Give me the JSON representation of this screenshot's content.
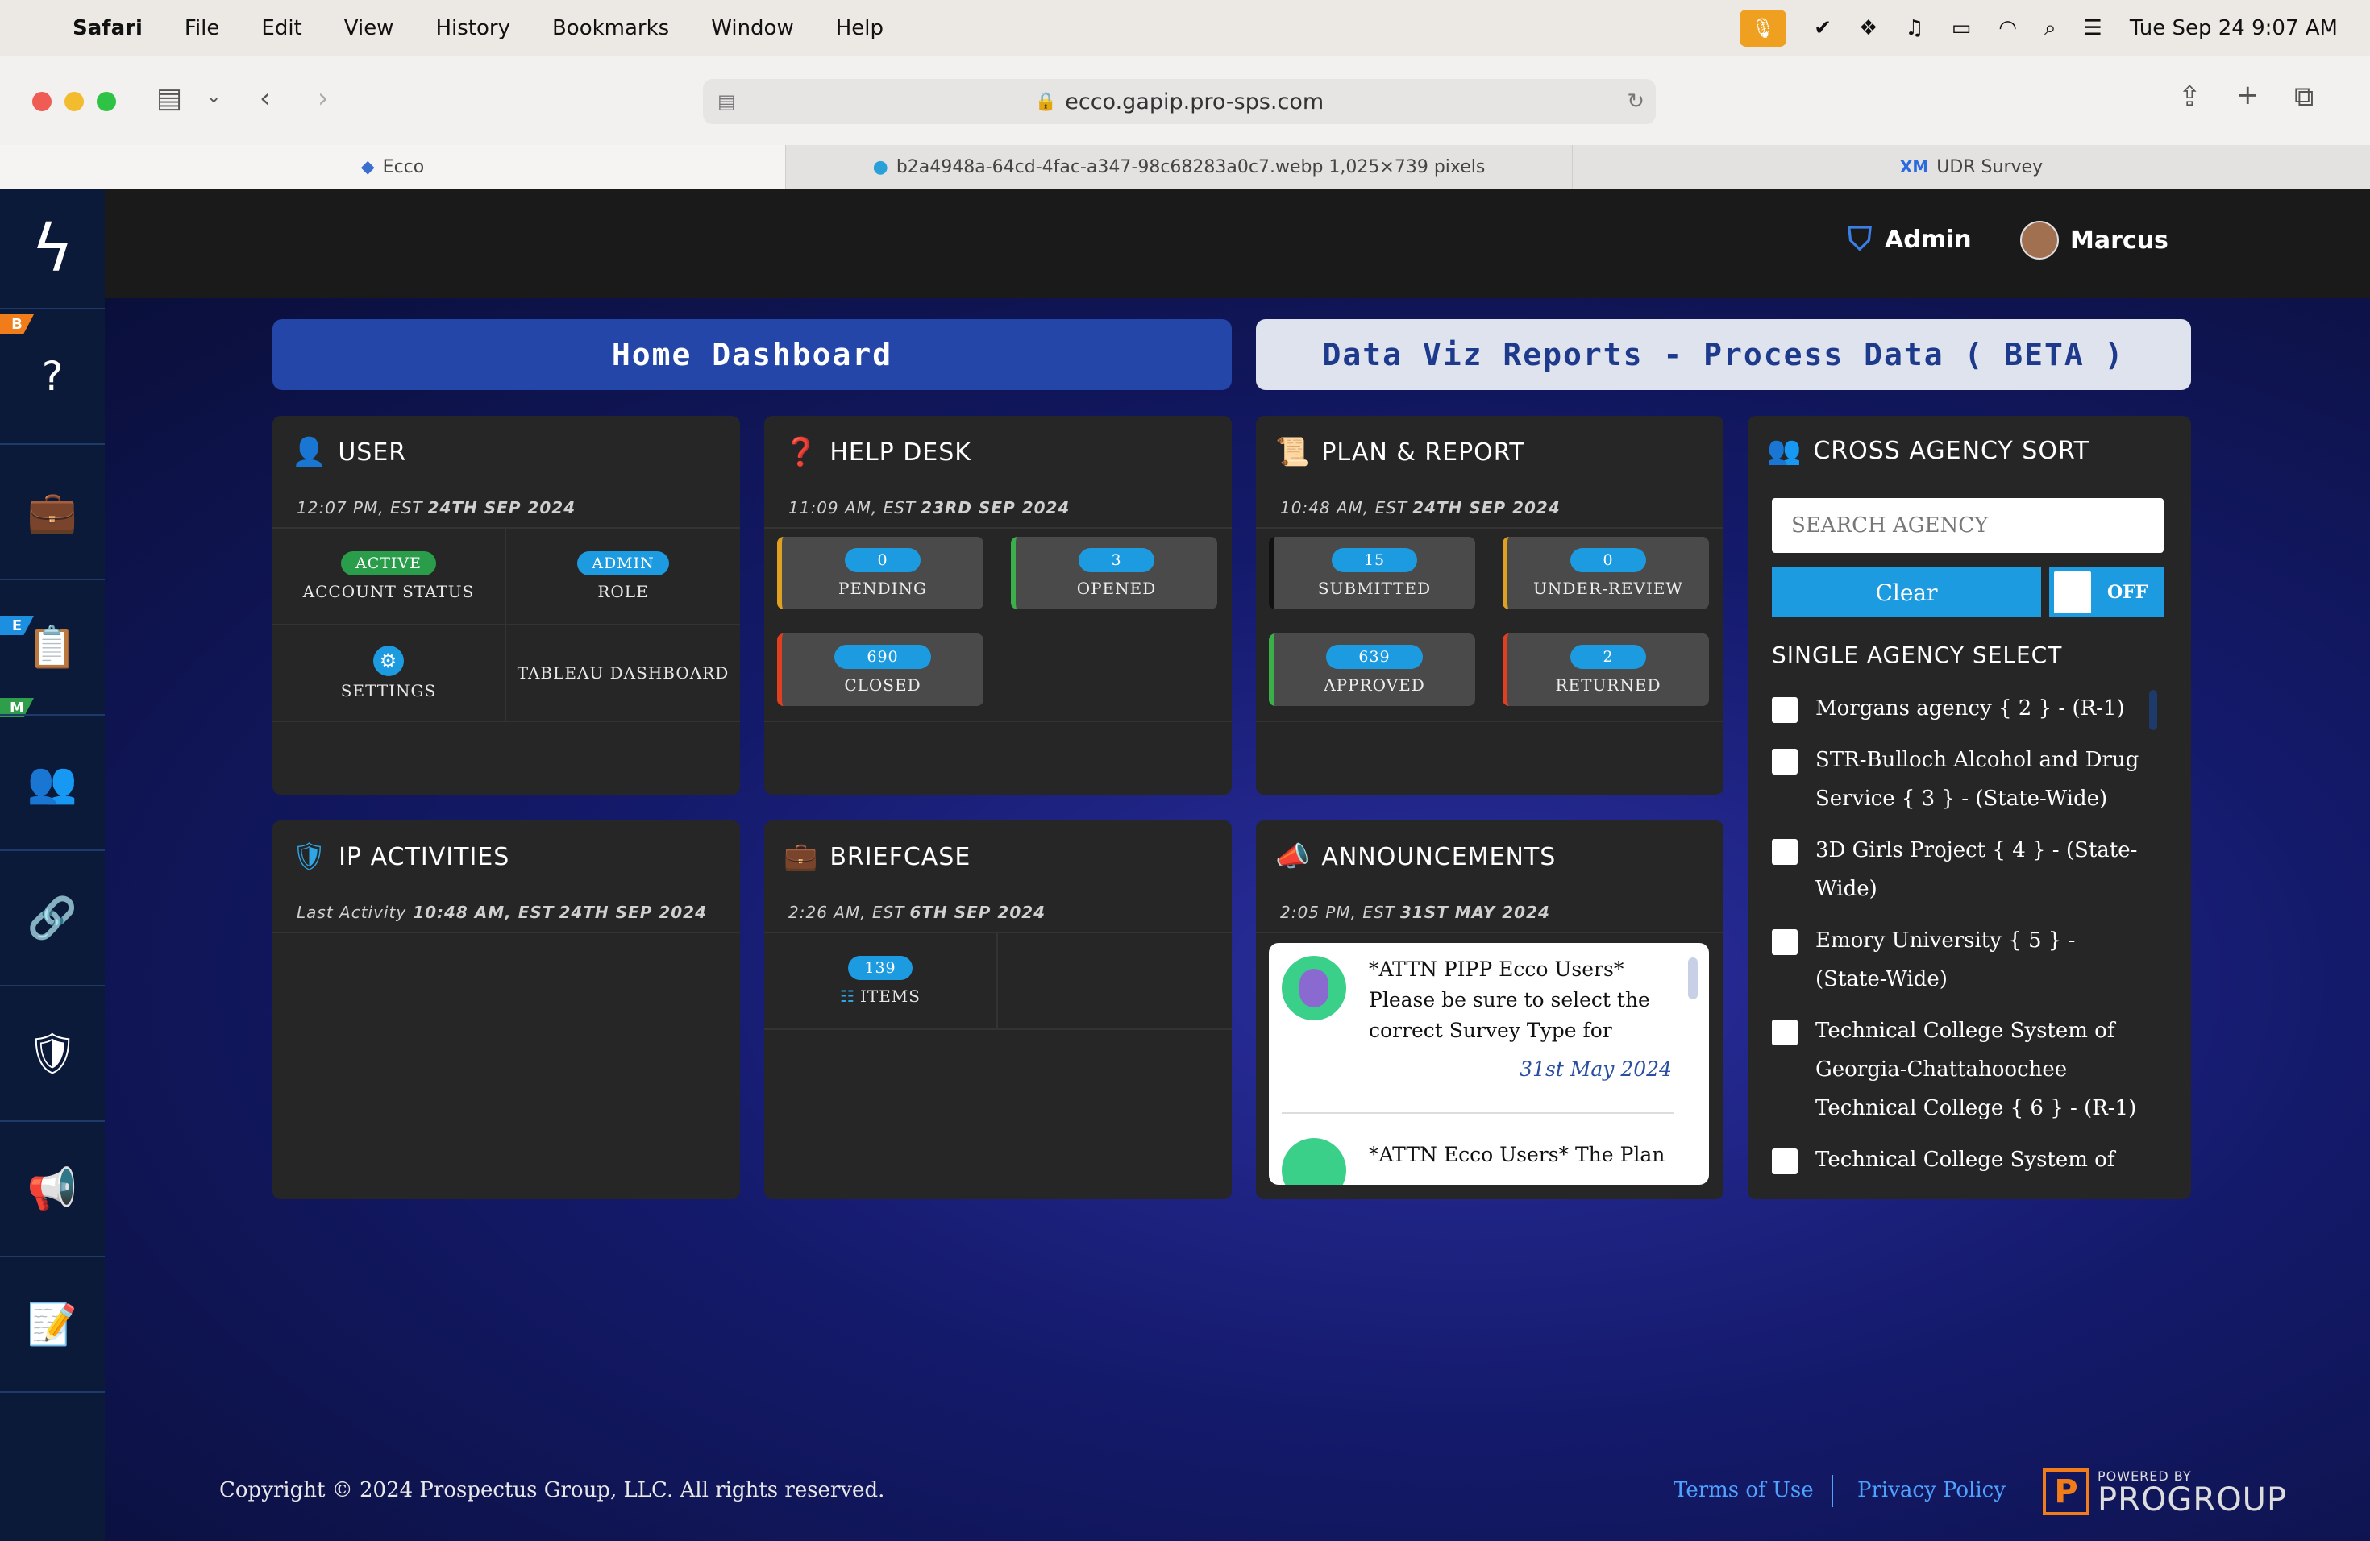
{
  "menubar": {
    "app": "Safari",
    "items": [
      "File",
      "Edit",
      "View",
      "History",
      "Bookmarks",
      "Window",
      "Help"
    ],
    "datetime": "Tue Sep 24  9:07 AM"
  },
  "browser": {
    "url": "ecco.gapip.pro-sps.com",
    "tabs": [
      {
        "label": "Ecco"
      },
      {
        "label": "b2a4948a-64cd-4fac-a347-98c68283a0c7.webp 1,025×739 pixels"
      },
      {
        "label": "UDR Survey"
      }
    ]
  },
  "topbar": {
    "admin_label": "Admin",
    "user_name": "Marcus"
  },
  "sidebar": {
    "badges": [
      "B",
      "E",
      "M"
    ]
  },
  "nav": {
    "home_dashboard": "Home Dashboard",
    "data_viz": "Data Viz Reports - Process Data ( BETA )"
  },
  "user_card": {
    "title": "USER",
    "time": "12:07 PM, EST",
    "date": "24TH SEP 2024",
    "status_pill": "ACTIVE",
    "status_label": "ACCOUNT STATUS",
    "role_pill": "ADMIN",
    "role_label": "ROLE",
    "settings_label": "SETTINGS",
    "tableau_label": "TABLEAU DASHBOARD"
  },
  "helpdesk_card": {
    "title": "HELP DESK",
    "time": "11:09 AM, EST",
    "date": "23RD SEP 2024",
    "pending": {
      "count": "0",
      "label": "PENDING"
    },
    "opened": {
      "count": "3",
      "label": "OPENED"
    },
    "closed": {
      "count": "690",
      "label": "CLOSED"
    }
  },
  "plan_card": {
    "title": "PLAN & REPORT",
    "time": "10:48 AM, EST",
    "date": "24TH SEP 2024",
    "submitted": {
      "count": "15",
      "label": "SUBMITTED"
    },
    "underreview": {
      "count": "0",
      "label": "UNDER-REVIEW"
    },
    "approved": {
      "count": "639",
      "label": "APPROVED"
    },
    "returned": {
      "count": "2",
      "label": "RETURNED"
    }
  },
  "ip_card": {
    "title": "IP ACTIVITIES",
    "prefix": "Last Activity",
    "time": "10:48 AM, EST",
    "date": "24TH SEP 2024"
  },
  "briefcase_card": {
    "title": "BRIEFCASE",
    "time": "2:26 AM, EST",
    "date": "6TH SEP 2024",
    "count": "139",
    "label": "ITEMS"
  },
  "announce_card": {
    "title": "ANNOUNCEMENTS",
    "time": "2:05 PM, EST",
    "date": "31ST MAY 2024",
    "items": [
      {
        "text": "*ATTN PIPP Ecco Users* Please be sure to select the correct Survey Type for",
        "date": "31st May 2024"
      },
      {
        "text": "*ATTN Ecco Users* The Plan"
      }
    ]
  },
  "agency_card": {
    "title": "CROSS AGENCY SORT",
    "search_placeholder": "SEARCH AGENCY",
    "clear_label": "Clear",
    "toggle_label": "OFF",
    "single_select": "SINGLE AGENCY SELECT",
    "agencies": [
      "Morgans agency { 2 } - (R-1)",
      "STR-Bulloch Alcohol and Drug Service { 3 } - (State-Wide)",
      "3D Girls Project { 4 } - (State-Wide)",
      "Emory University { 5 } - (State-Wide)",
      "Technical College System of Georgia-Chattahoochee Technical College { 6 } - (R-1)",
      "Technical College System of"
    ]
  },
  "footer": {
    "copyright": "Copyright © 2024 Prospectus Group, LLC. All rights reserved.",
    "terms": "Terms of Use",
    "privacy": "Privacy Policy",
    "powered": "POWERED BY",
    "brand": "PROGROUP"
  }
}
